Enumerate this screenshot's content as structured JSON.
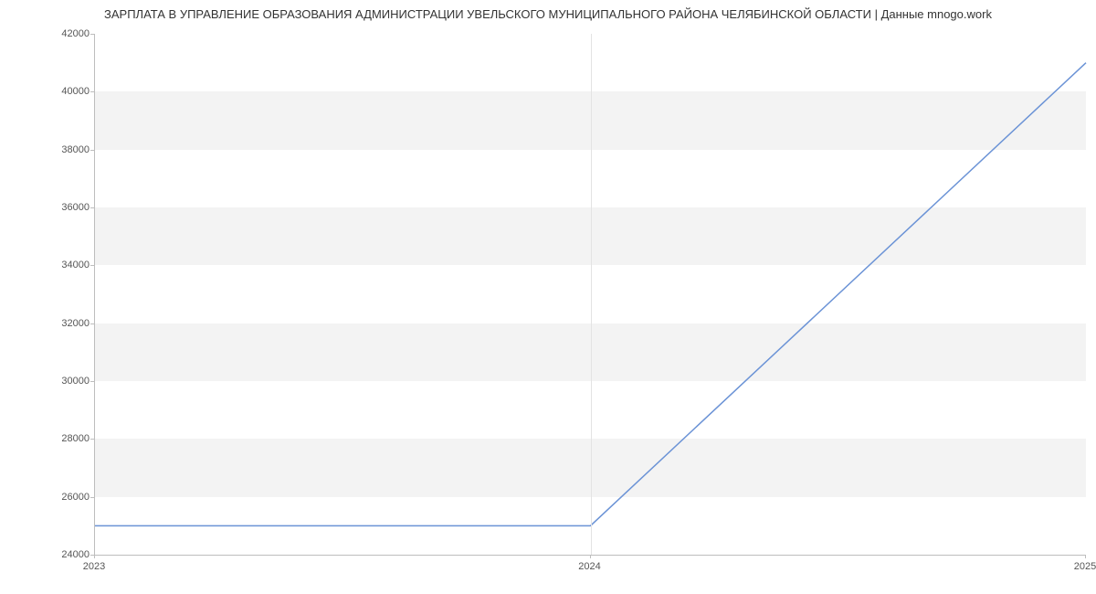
{
  "chart_data": {
    "type": "line",
    "title": "ЗАРПЛАТА В УПРАВЛЕНИЕ ОБРАЗОВАНИЯ АДМИНИСТРАЦИИ УВЕЛЬСКОГО МУНИЦИПАЛЬНОГО РАЙОНА ЧЕЛЯБИНСКОЙ ОБЛАСТИ | Данные mnogo.work",
    "xlabel": "",
    "ylabel": "",
    "x_categories": [
      "2023",
      "2024",
      "2025"
    ],
    "x_positions": [
      0,
      0.5,
      1
    ],
    "y_ticks": [
      24000,
      26000,
      28000,
      30000,
      32000,
      34000,
      36000,
      38000,
      40000,
      42000
    ],
    "ylim": [
      24000,
      42000
    ],
    "x": [
      0,
      0.5,
      1
    ],
    "values": [
      25000,
      25000,
      41000
    ],
    "line_color": "#6b93d6",
    "band_color": "#f3f3f3"
  }
}
